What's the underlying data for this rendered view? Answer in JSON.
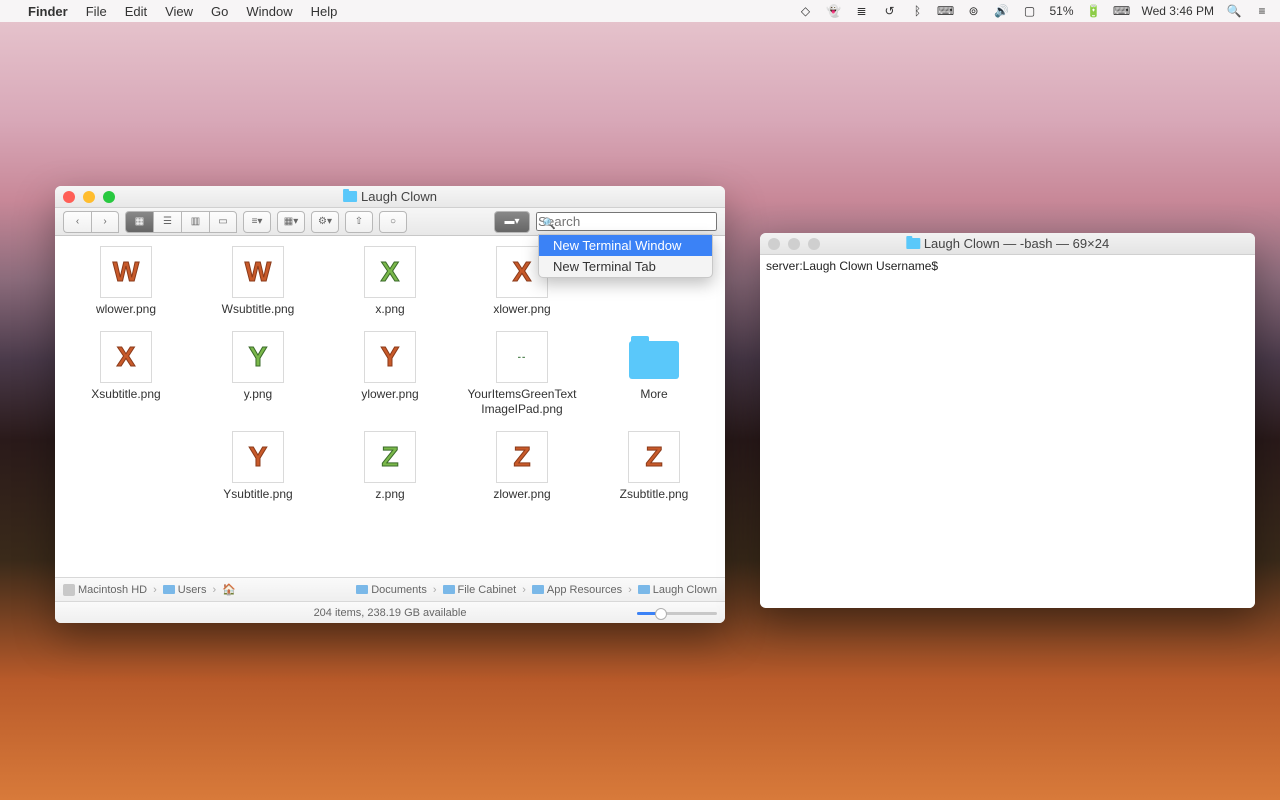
{
  "menubar": {
    "app": "Finder",
    "items": [
      "File",
      "Edit",
      "View",
      "Go",
      "Window",
      "Help"
    ],
    "battery": "51%",
    "clock": "Wed 3:46 PM"
  },
  "finder": {
    "title": "Laugh Clown",
    "search_placeholder": "Search",
    "dropdown": {
      "new_window": "New Terminal Window",
      "new_tab": "New Terminal Tab"
    },
    "files": [
      {
        "label": "wlower.png",
        "glyph": "W",
        "cls": "orange"
      },
      {
        "label": "Wsubtitle.png",
        "glyph": "W",
        "cls": "orange"
      },
      {
        "label": "x.png",
        "glyph": "X",
        "cls": "green"
      },
      {
        "label": "xlower.png",
        "glyph": "X",
        "cls": "orange"
      },
      {
        "label": "Xsubtitle.png",
        "glyph": "X",
        "cls": "orange"
      },
      {
        "label": "y.png",
        "glyph": "Y",
        "cls": "green"
      },
      {
        "label": "ylower.png",
        "glyph": "Y",
        "cls": "orange"
      },
      {
        "label": "YourItemsGreenTextImageIPad.png",
        "glyph": "--",
        "cls": "generic"
      },
      {
        "label": "More",
        "glyph": "",
        "cls": "folder"
      },
      {
        "label": "Ysubtitle.png",
        "glyph": "Y",
        "cls": "orange"
      },
      {
        "label": "z.png",
        "glyph": "Z",
        "cls": "green"
      },
      {
        "label": "zlower.png",
        "glyph": "Z",
        "cls": "orange"
      },
      {
        "label": "Zsubtitle.png",
        "glyph": "Z",
        "cls": "orange"
      }
    ],
    "path": [
      "Macintosh HD",
      "Users",
      "🏠",
      "Documents",
      "File Cabinet",
      "App Resources",
      "Laugh Clown"
    ],
    "status": "204 items, 238.19 GB available"
  },
  "terminal": {
    "title": "Laugh Clown — -bash — 69×24",
    "prompt": "server:Laugh Clown Username$ "
  }
}
